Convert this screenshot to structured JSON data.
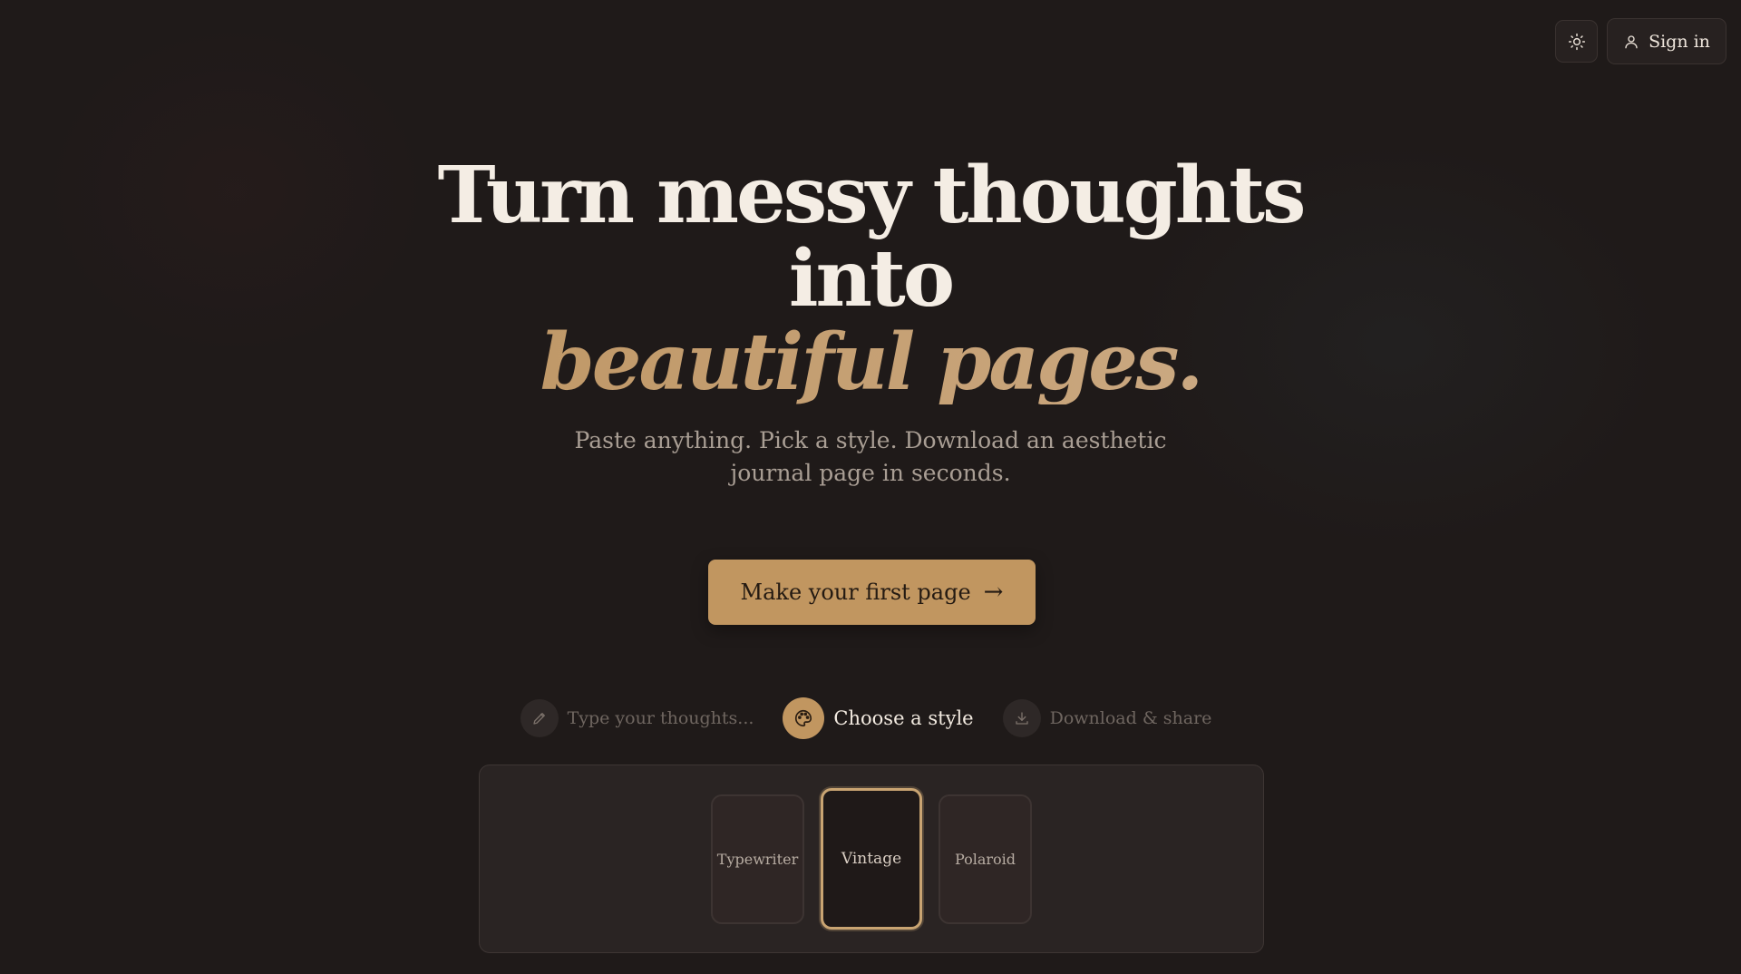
{
  "header": {
    "theme_toggle_icon": "sun-icon",
    "signin_icon": "user-icon",
    "signin_label": "Sign in"
  },
  "hero": {
    "headline_line1": "Turn messy thoughts",
    "headline_line2": "into",
    "headline_accent": "beautiful pages.",
    "subtitle": "Paste anything. Pick a style. Download an aesthetic journal page in seconds.",
    "cta_label": "Make your first page",
    "cta_arrow": "→"
  },
  "steps": [
    {
      "label": "Type your thoughts...",
      "icon": "pencil-icon",
      "state": "inactive"
    },
    {
      "label": "Choose a style",
      "icon": "palette-icon",
      "state": "active"
    },
    {
      "label": "Download & share",
      "icon": "download-icon",
      "state": "inactive"
    }
  ],
  "styles": {
    "options": [
      "Typewriter",
      "Vintage",
      "Polaroid"
    ],
    "selected": "Vintage"
  },
  "colors": {
    "background": "#1f1a19",
    "accent": "#c19660",
    "text": "#f4ede4",
    "muted": "#a99e94"
  }
}
